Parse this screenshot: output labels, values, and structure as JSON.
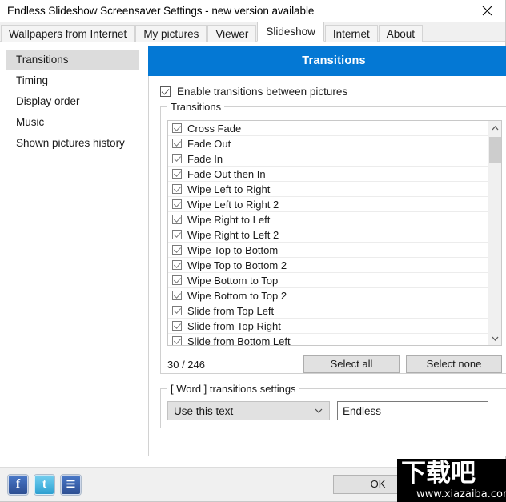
{
  "window": {
    "title": "Endless Slideshow Screensaver Settings - new version available",
    "close_icon": "close-icon"
  },
  "tabs": [
    {
      "label": "Wallpapers from Internet",
      "active": false
    },
    {
      "label": "My pictures",
      "active": false
    },
    {
      "label": "Viewer",
      "active": false
    },
    {
      "label": "Slideshow",
      "active": true
    },
    {
      "label": "Internet",
      "active": false
    },
    {
      "label": "About",
      "active": false
    }
  ],
  "sidebar": {
    "items": [
      {
        "label": "Transitions",
        "selected": true
      },
      {
        "label": "Timing",
        "selected": false
      },
      {
        "label": "Display order",
        "selected": false
      },
      {
        "label": "Music",
        "selected": false
      },
      {
        "label": "Shown pictures history",
        "selected": false
      }
    ]
  },
  "panel": {
    "header": "Transitions",
    "header_color": "#0478D4",
    "enable_checkbox": {
      "label": "Enable transitions between pictures",
      "checked": true
    },
    "transitions_group_title": "Transitions",
    "transitions": [
      {
        "label": "Cross Fade",
        "checked": true
      },
      {
        "label": "Fade Out",
        "checked": true
      },
      {
        "label": "Fade In",
        "checked": true
      },
      {
        "label": "Fade Out then In",
        "checked": true
      },
      {
        "label": "Wipe Left to Right",
        "checked": true
      },
      {
        "label": "Wipe Left to Right 2",
        "checked": true
      },
      {
        "label": "Wipe Right to Left",
        "checked": true
      },
      {
        "label": "Wipe Right to Left 2",
        "checked": true
      },
      {
        "label": "Wipe Top to Bottom",
        "checked": true
      },
      {
        "label": "Wipe Top to Bottom 2",
        "checked": true
      },
      {
        "label": "Wipe Bottom to Top",
        "checked": true
      },
      {
        "label": "Wipe Bottom to Top 2",
        "checked": true
      },
      {
        "label": "Slide from Top Left",
        "checked": true
      },
      {
        "label": "Slide from Top Right",
        "checked": true
      },
      {
        "label": "Slide from Bottom Left",
        "checked": true
      }
    ],
    "counter": "30 / 246",
    "select_all_label": "Select all",
    "select_none_label": "Select none",
    "word_group_title": "[ Word ] transitions settings",
    "word_select_value": "Use this text",
    "word_text_value": "Endless"
  },
  "footer": {
    "social": [
      {
        "name": "facebook-icon",
        "glyph": "f"
      },
      {
        "name": "twitter-icon",
        "glyph": "t"
      },
      {
        "name": "myspace-icon",
        "glyph": "☰"
      }
    ],
    "ok_label": "OK"
  },
  "watermark": {
    "logo": "下载吧",
    "url": "www.xiazaiba.com"
  }
}
